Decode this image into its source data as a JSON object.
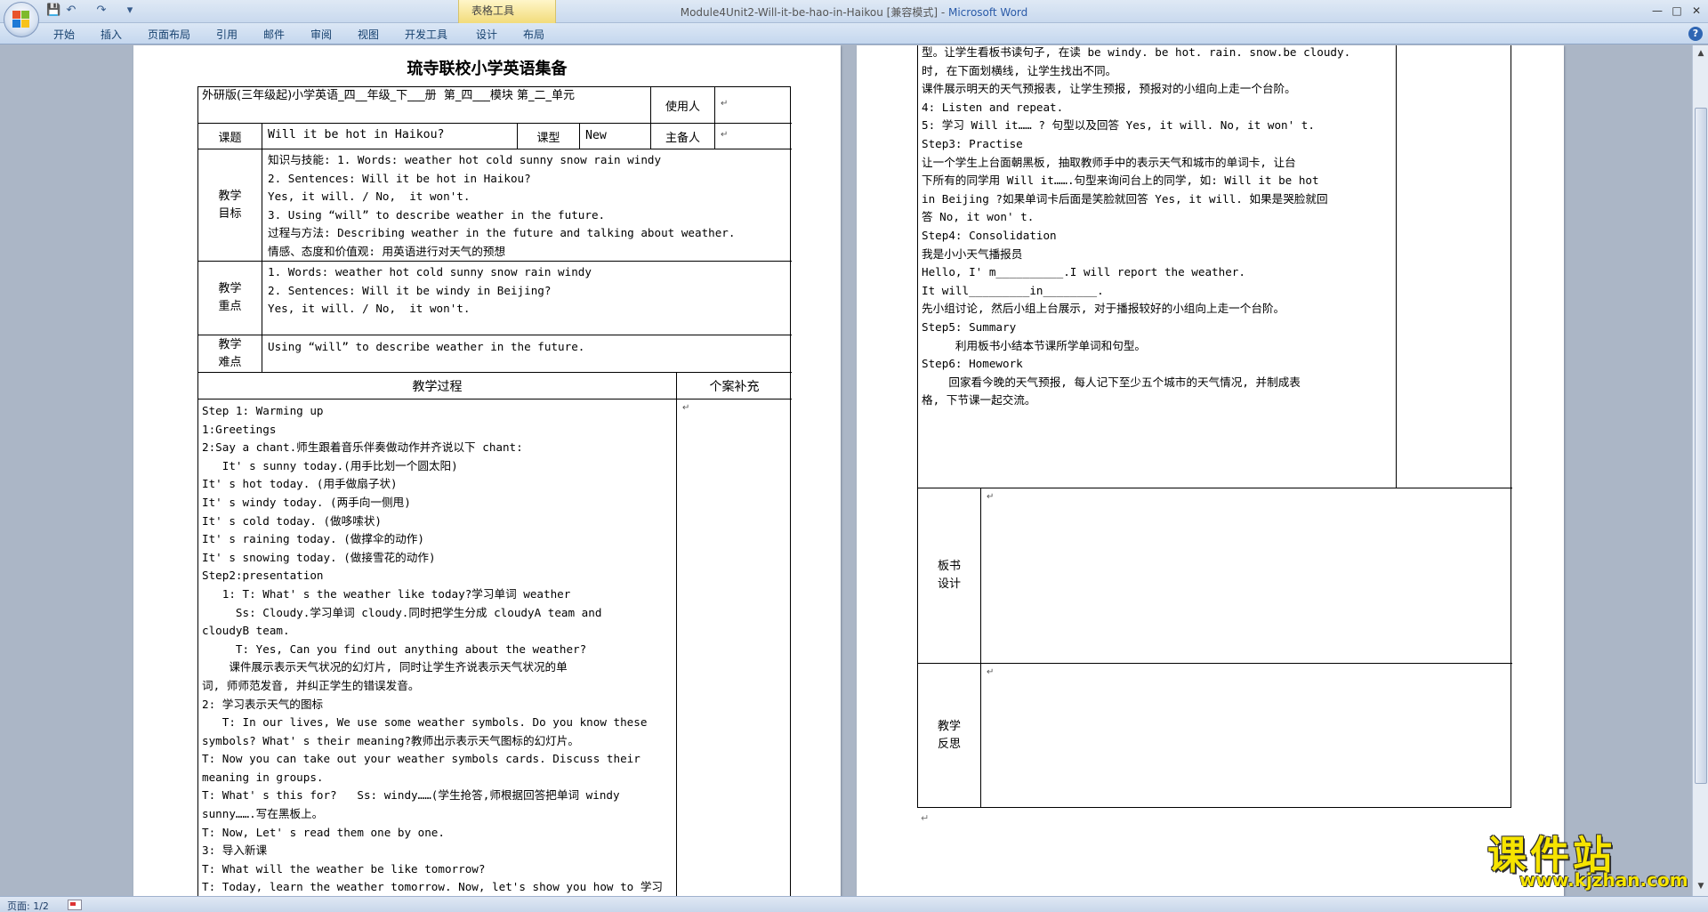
{
  "window": {
    "doc_title": "Module4Unit2-Will-it-be-hao-in-Haikou [兼容模式]",
    "separator": " - ",
    "app_name": "Microsoft Word",
    "context_tab_group": "表格工具"
  },
  "quick_access": {
    "save": "💾",
    "undo": "↶",
    "redo": "↷",
    "more": "▾"
  },
  "ribbon": {
    "tabs": [
      "开始",
      "插入",
      "页面布局",
      "引用",
      "邮件",
      "审阅",
      "视图",
      "开发工具",
      "设计",
      "布局"
    ]
  },
  "window_controls": {
    "minimize": "—",
    "maximize": "□",
    "close": "✕",
    "help": "?"
  },
  "page1": {
    "title": "琉寺联校小学英语集备",
    "header_row": {
      "book_info": "外研版(三年级起)小学英语_四__年级_下___册  第_四___模块 第_二_单元",
      "user_label": "使用人",
      "user_value": ""
    },
    "topic_row": {
      "topic_label": "课题",
      "topic_value": "Will it be hot in Haikou?",
      "type_label": "课型",
      "type_value": "New",
      "preparer_label": "主备人",
      "preparer_value": ""
    },
    "objectives": {
      "label": "教学\n目标",
      "text": "知识与技能: 1. Words: weather hot cold sunny snow rain windy\n2. Sentences: Will it be hot in Haikou?\nYes, it will. / No,  it won't.\n3. Using “will” to describe weather in the future.\n过程与方法: Describing weather in the future and talking about weather.\n情感、态度和价值观: 用英语进行对天气的预想"
    },
    "key_points": {
      "label": "教学\n重点",
      "text": "1. Words: weather hot cold sunny snow rain windy\n2. Sentences: Will it be windy in Beijing?\nYes, it will. / No,  it won't."
    },
    "difficulties": {
      "label": "教学\n难点",
      "text": "Using “will” to describe weather in the future."
    },
    "process_header": "教学过程",
    "supplement_header": "个案补充",
    "process_text": "Step 1: Warming up\n1:Greetings\n2:Say a chant.师生跟着音乐伴奏做动作并齐说以下 chant:\n   It' s sunny today.(用手比划一个圆太阳)\nIt' s hot today. (用手做扇子状)\nIt' s windy today. (两手向一侧甩)\nIt' s cold today. (做哆嗦状)\nIt' s raining today. (做撑伞的动作)\nIt' s snowing today. (做接雪花的动作)\nStep2:presentation\n   1: T: What' s the weather like today?学习单词 weather\n     Ss: Cloudy.学习单词 cloudy.同时把学生分成 cloudyA team and\ncloudyB team.\n     T: Yes, Can you find out anything about the weather?\n    课件展示表示天气状况的幻灯片, 同时让学生齐说表示天气状况的单\n词, 师师范发音, 并纠正学生的错误发音。\n2: 学习表示天气的图标\n   T: In our lives, We use some weather symbols. Do you know these\nsymbols? What' s their meaning?教师出示表示天气图标的幻灯片。\nT: Now you can take out your weather symbols cards. Discuss their\nmeaning in groups.\nT: What' s this for?   Ss: windy……(学生抢答,师根据回答把单词 windy\nsunny…….写在黑板上。\nT: Now, Let' s read them one by one.\n3: 导入新课\nT: What will the weather be like tomorrow?\nT: Today, learn the weather tomorrow. Now, let's show you how to 学习句"
  },
  "page2": {
    "process_text": "型。让学生看板书读句子, 在读 be windy. be hot. rain. snow.be cloudy.\n时, 在下面划横线, 让学生找出不同。\n课件展示明天的天气预报表, 让学生预报, 预报对的小组向上走一个台阶。\n4: Listen and repeat.\n5: 学习 Will it…… ? 句型以及回答 Yes, it will. No, it won' t.\nStep3: Practise\n让一个学生上台面朝黑板, 抽取教师手中的表示天气和城市的单词卡, 让台\n下所有的同学用 Will it…….句型来询问台上的同学, 如: Will it be hot\nin Beijing ?如果单词卡后面是笑脸就回答 Yes, it will. 如果是哭脸就回\n答 No, it won' t.\nStep4: Consolidation\n我是小小天气播报员\nHello, I' m__________.I will report the weather.\nIt will_________in________.\n先小组讨论, 然后小组上台展示, 对于播报较好的小组向上走一个台阶。\nStep5: Summary\n     利用板书小结本节课所学单词和句型。\nStep6: Homework\n    回家看今晚的天气预报, 每人记下至少五个城市的天气情况, 并制成表\n格, 下节课一起交流。",
    "board_label": "板书\n设计",
    "board_value": "",
    "reflection_label": "教学\n反思",
    "reflection_value": ""
  },
  "status_bar": {
    "page": "页面: 1/2"
  },
  "watermark": {
    "big": "课件站",
    "small": "www.kjzhan.com"
  },
  "marks": {
    "cell_end": "↵"
  }
}
